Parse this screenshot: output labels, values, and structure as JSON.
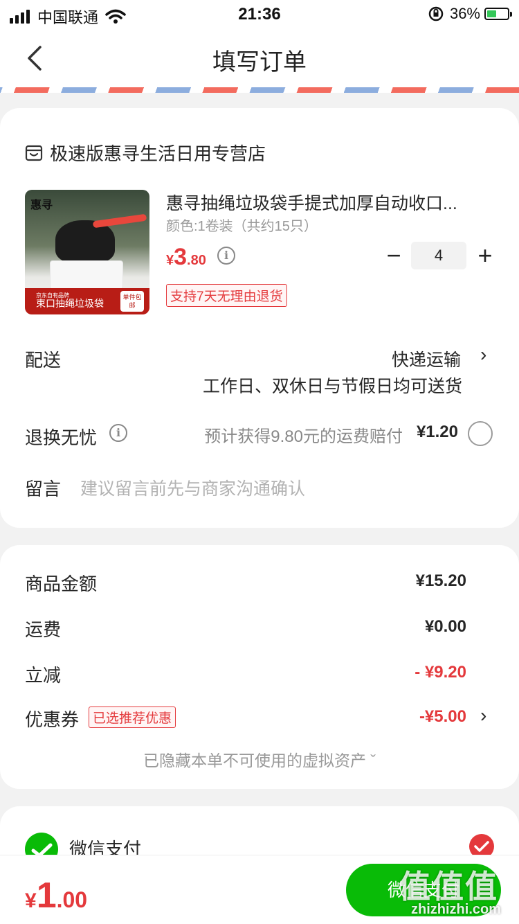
{
  "status_bar": {
    "carrier": "中国联通",
    "time": "21:36",
    "battery": "36%"
  },
  "nav": {
    "title": "填写订单"
  },
  "shop": {
    "name": "极速版惠寻生活日用专营店"
  },
  "product": {
    "image": {
      "brand": "惠寻",
      "band_small": "京东自有品牌",
      "band_text": "束口抽绳垃圾袋",
      "badge": "单件包邮"
    },
    "title": "惠寻抽绳垃圾袋手提式加厚自动收口...",
    "spec": "颜色:1卷装（共约15只）",
    "price": {
      "yen": "¥",
      "int": "3",
      "dec": ".80"
    },
    "quantity": "4",
    "qty_minus": "−",
    "qty_plus": "+",
    "return_tag": "支持7天无理由退货"
  },
  "delivery": {
    "label": "配送",
    "method": "快递运输",
    "sub": "工作日、双休日与节假日均可送货",
    "chevron": "›"
  },
  "return_freight": {
    "label": "退换无忧",
    "desc": "预计获得9.80元的运费赔付",
    "price": "¥1.20"
  },
  "message": {
    "label": "留言",
    "placeholder": "建议留言前先与商家沟通确认"
  },
  "summary": {
    "goods_label": "商品金额",
    "goods_amount": "¥15.20",
    "shipping_label": "运费",
    "shipping_amount": "¥0.00",
    "discount_label": "立减",
    "discount_amount": "- ¥9.20",
    "coupon_label": "优惠券",
    "coupon_tag": "已选推荐优惠",
    "coupon_amount": "-¥5.00",
    "coupon_chevron": "›",
    "hidden_note": "已隐藏本单不可使用的虚拟资产 ˇ"
  },
  "payment": {
    "method": "微信支付"
  },
  "bottom": {
    "total": {
      "yen": "¥",
      "int": "1",
      "dec": ".00"
    },
    "pay_button": "微信支付"
  },
  "watermark": {
    "text": "值值值",
    "url": "zhizhizhi.com"
  },
  "colors": {
    "accent_red": "#e4393c",
    "wechat_green": "#09bb07"
  },
  "icons": [
    "signal-icon",
    "wifi-icon",
    "orientation-lock-icon",
    "battery-icon",
    "back-arrow-icon",
    "shop-icon",
    "info-icon",
    "radio-icon",
    "wechat-pay-icon",
    "checkmark-icon",
    "chevron-right-icon"
  ]
}
